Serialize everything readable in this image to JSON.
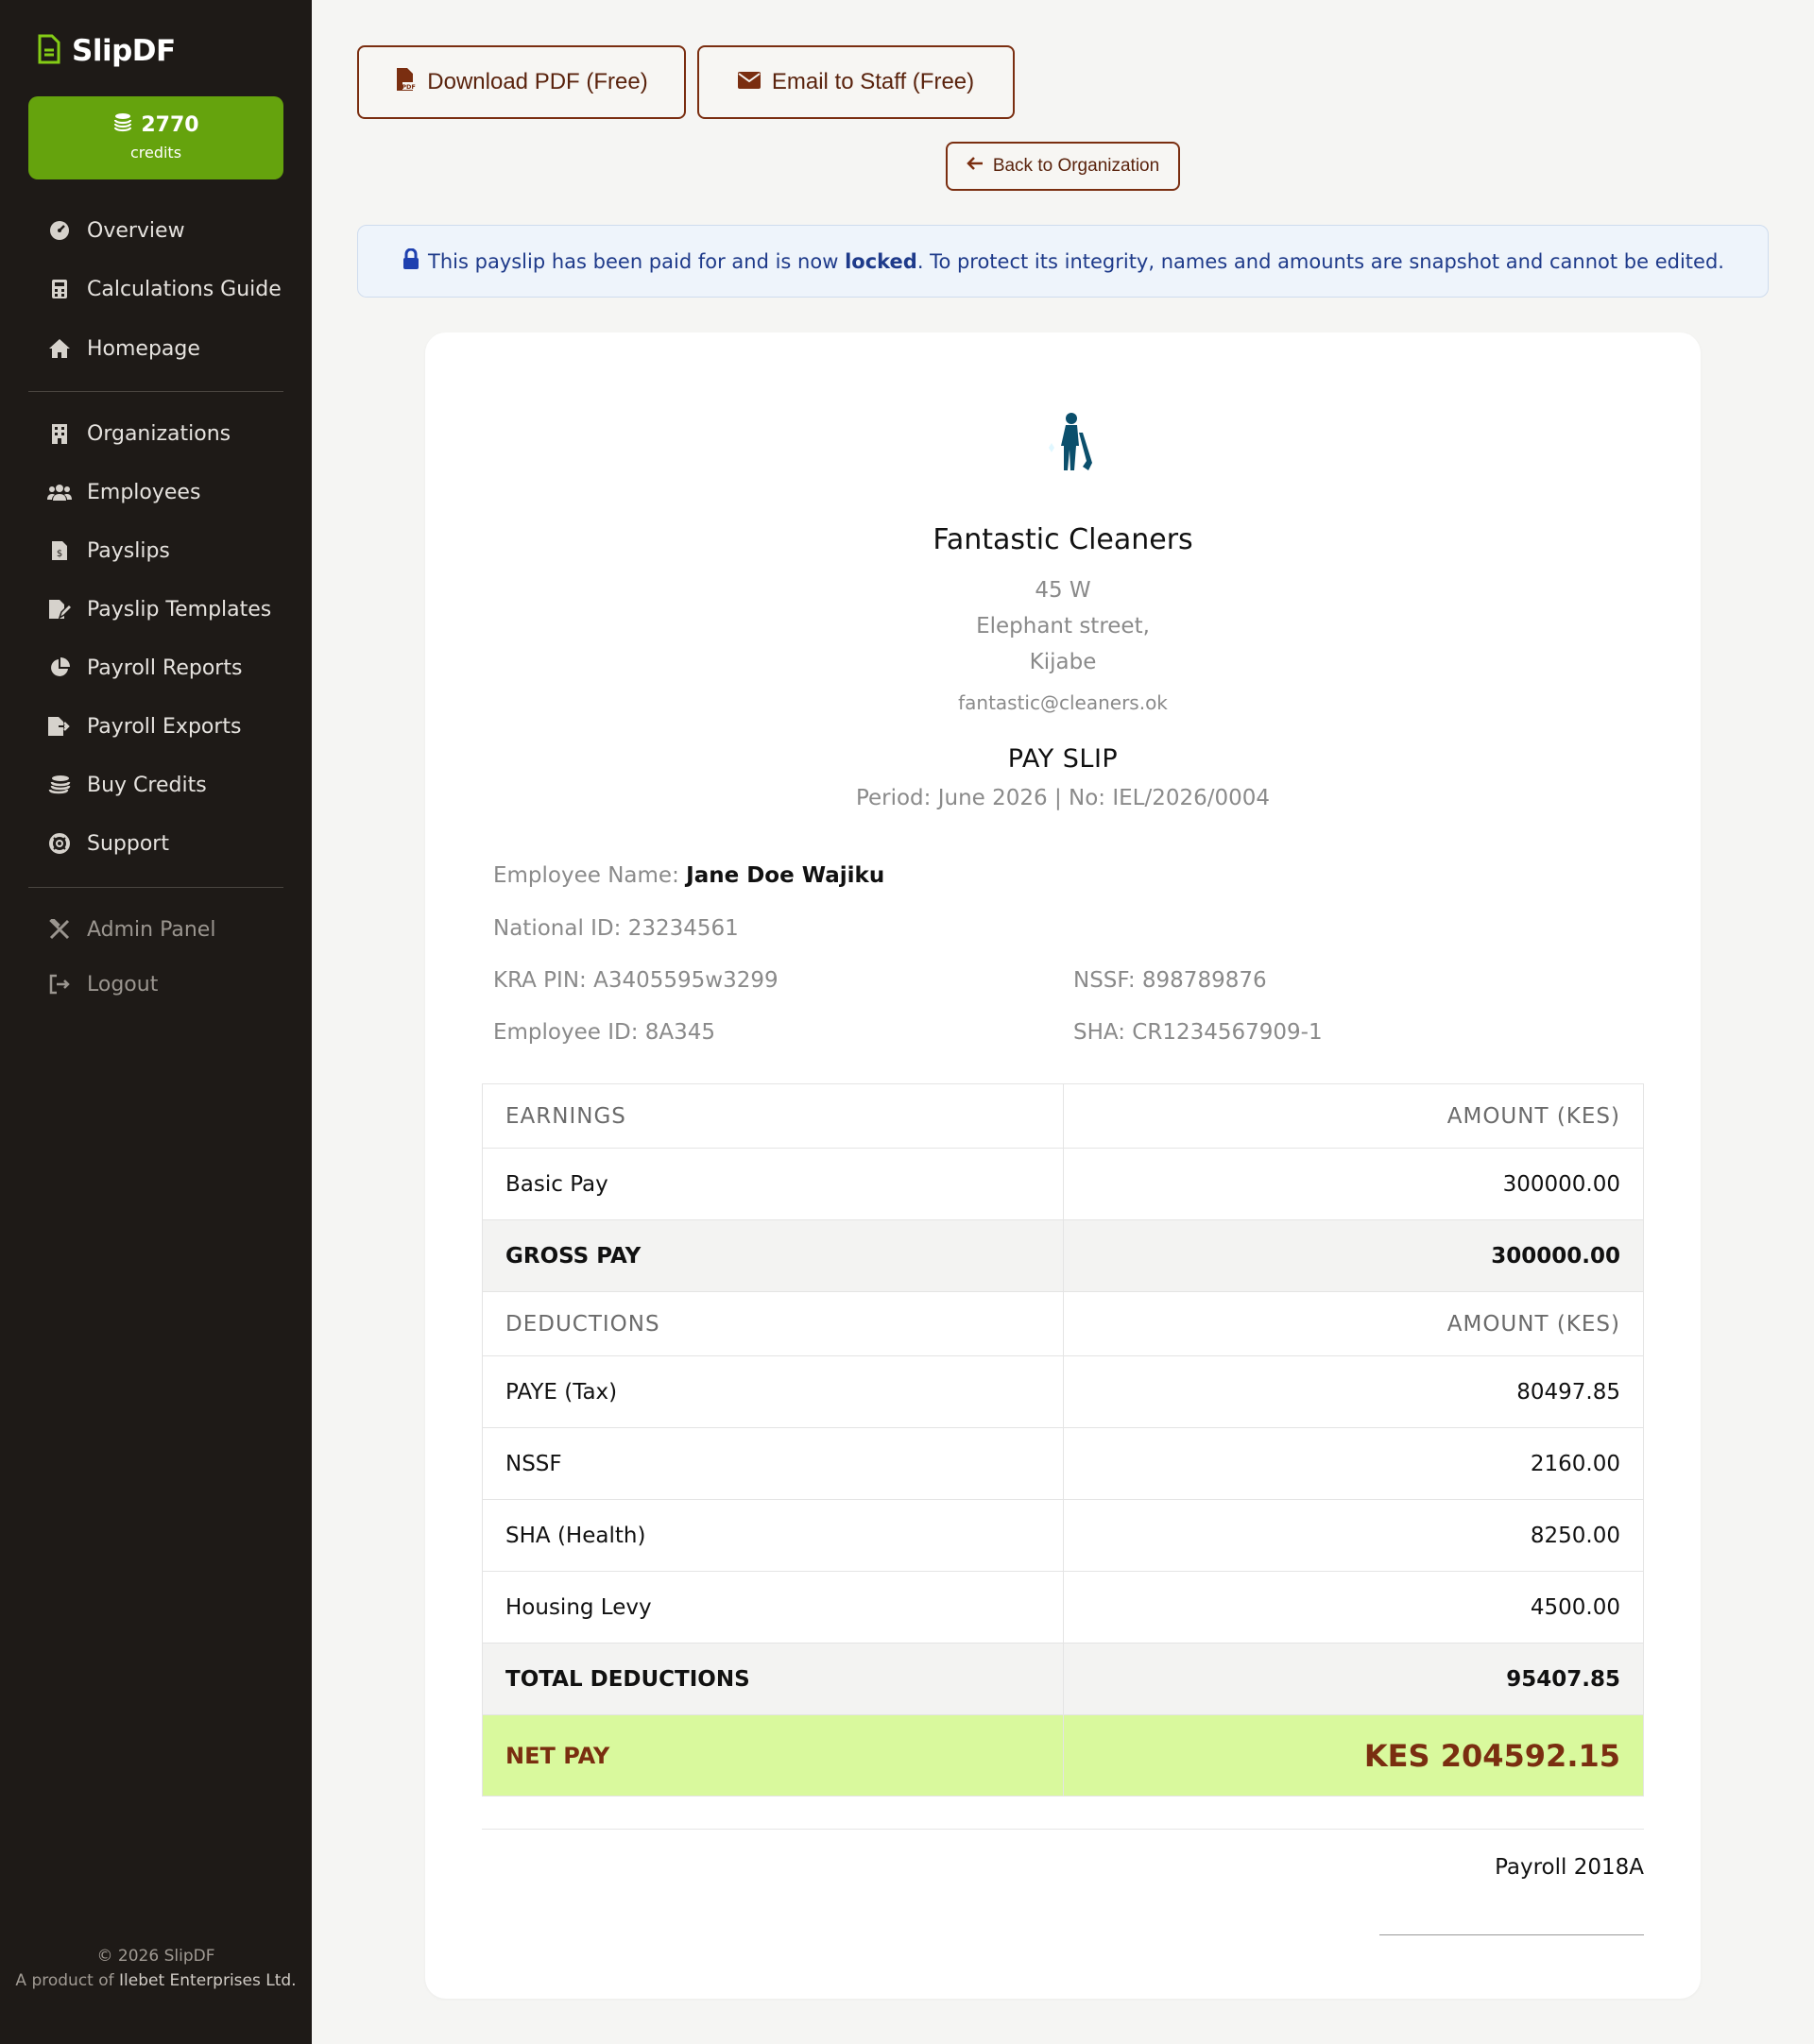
{
  "sidebar": {
    "brand": "SlipDF",
    "credits_value": "2770",
    "credits_label": "credits",
    "nav_primary": [
      {
        "label": "Overview",
        "icon": "dashboard-icon"
      },
      {
        "label": "Calculations Guide",
        "icon": "calculator-icon"
      },
      {
        "label": "Homepage",
        "icon": "home-icon"
      }
    ],
    "nav_secondary": [
      {
        "label": "Organizations",
        "icon": "building-icon"
      },
      {
        "label": "Employees",
        "icon": "users-icon"
      },
      {
        "label": "Payslips",
        "icon": "invoice-icon"
      },
      {
        "label": "Payslip Templates",
        "icon": "file-edit-icon"
      },
      {
        "label": "Payroll Reports",
        "icon": "pie-chart-icon"
      },
      {
        "label": "Payroll Exports",
        "icon": "file-export-icon"
      },
      {
        "label": "Buy Credits",
        "icon": "coins-icon"
      },
      {
        "label": "Support",
        "icon": "lifebuoy-icon"
      }
    ],
    "nav_tertiary": [
      {
        "label": "Admin Panel",
        "icon": "tools-icon"
      },
      {
        "label": "Logout",
        "icon": "logout-icon"
      }
    ],
    "footer_copyright": "© 2026 SlipDF",
    "footer_product_prefix": "A product of",
    "footer_company": "Ilebet Enterprises Ltd."
  },
  "actions": {
    "download_label": "Download PDF (Free)",
    "email_label": "Email to Staff (Free)",
    "back_label": "Back to Organization"
  },
  "banner": {
    "text_before": "This payslip has been paid for and is now",
    "text_strong": "locked",
    "text_after": ". To protect its integrity, names and amounts are snapshot and cannot be edited."
  },
  "payslip": {
    "org_name": "Fantastic Cleaners",
    "address_line1": "45 W",
    "address_line2": "Elephant street,",
    "address_line3": "Kijabe",
    "email": "fantastic@cleaners.ok",
    "title": "PAY SLIP",
    "period": "Period: June 2026 | No: IEL/2026/0004",
    "employee_name_label": "Employee Name:",
    "employee_name": "Jane Doe Wajiku",
    "national_id": "National ID: 23234561",
    "kra_pin": "KRA PIN: A3405595w3299",
    "nssf_no": "NSSF: 898789876",
    "employee_id": "Employee ID: 8A345",
    "sha_no": "SHA: CR1234567909-1",
    "earnings_header": "EARNINGS",
    "amount_header": "AMOUNT (KES)",
    "earnings": [
      {
        "label": "Basic Pay",
        "amount": "300000.00"
      }
    ],
    "gross_label": "GROSS PAY",
    "gross_amount": "300000.00",
    "deductions_header": "DEDUCTIONS",
    "deductions": [
      {
        "label": "PAYE (Tax)",
        "amount": "80497.85"
      },
      {
        "label": "NSSF",
        "amount": "2160.00"
      },
      {
        "label": "SHA (Health)",
        "amount": "8250.00"
      },
      {
        "label": "Housing Levy",
        "amount": "4500.00"
      }
    ],
    "total_deductions_label": "TOTAL DEDUCTIONS",
    "total_deductions_amount": "95407.85",
    "net_label": "NET PAY",
    "net_amount": "KES 204592.15",
    "signatory": "Payroll 2018A"
  },
  "colors": {
    "sidebar_bg": "#1e1a17",
    "credits_green": "#65a30d",
    "accent_brown": "#7a2e10",
    "net_pay_bg": "#d9f99d",
    "banner_bg": "#eef4fb"
  }
}
